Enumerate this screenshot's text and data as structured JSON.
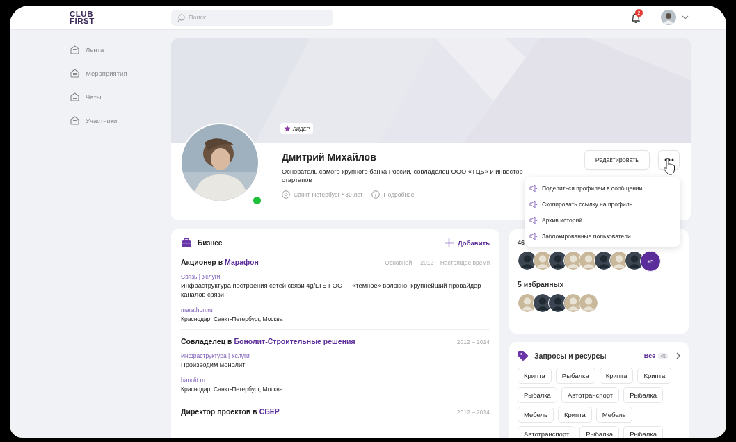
{
  "logo": [
    "CLUB",
    "FIRST"
  ],
  "search": {
    "placeholder": "Поиск"
  },
  "notifications": {
    "count": "2"
  },
  "sidebar": {
    "items": [
      {
        "label": "Лента"
      },
      {
        "label": "Мероприятия"
      },
      {
        "label": "Чаты"
      },
      {
        "label": "Участники"
      }
    ]
  },
  "profile": {
    "badge": "ЛИДЕР",
    "name": "Дмитрий Михайлов",
    "bio": "Основатель самого крупного банка России, совладелец ООО «ТЦБ» и инвестор стартапов",
    "online": true,
    "location": "Санкт-Петербург • 39 лет",
    "details_link": "Подробнее",
    "edit_button": "Редактировать"
  },
  "menu": {
    "items": [
      "Поделиться профилем в сообщении",
      "Скопировать ссылку на профиль",
      "Архив историй",
      "Заблокированные пользователи"
    ]
  },
  "business": {
    "title": "Бизнес",
    "add_button": "Добавить",
    "entries": [
      {
        "role": "Акционер в",
        "company": "Марафон",
        "tag": "Основной",
        "period": "2012 – Настоящее время",
        "categories": "Связь | Услуги",
        "description": "Инфраструктура построения сетей связи 4g/LTE FOC — «тёмное» волокно, крупнейший провайдер каналов связи",
        "site": "marathon.ru",
        "cities": "Краснодар, Санкт-Петербург, Москва"
      },
      {
        "role": "Совладелец в",
        "company": "Бонолит-Строительные решения",
        "period": "2012 – 2014",
        "categories": "Инфраструктура | Услуги",
        "description": "Производим монолит",
        "site": "banolit.ru",
        "cities": "Краснодар, Санкт-Петербург, Москва"
      },
      {
        "role": "Директор проектов в",
        "company": "СБЕР",
        "period": "2012 – 2014"
      }
    ]
  },
  "contacts": {
    "count": "46",
    "avatars": [
      {
        "kind": "dark"
      },
      {
        "kind": "light"
      },
      {
        "kind": "dark"
      },
      {
        "kind": "light"
      },
      {
        "kind": "light"
      },
      {
        "kind": "dark"
      },
      {
        "kind": "light"
      },
      {
        "kind": "dark"
      }
    ],
    "more": "+5",
    "favorites_title": "5 избранных",
    "favorites": [
      {
        "kind": "light"
      },
      {
        "kind": "dark"
      },
      {
        "kind": "dark"
      },
      {
        "kind": "light"
      },
      {
        "kind": "light"
      }
    ]
  },
  "requests": {
    "title": "Запросы и ресурсы",
    "all_link": "Все",
    "count": "45",
    "tags": [
      "Крипта",
      "Рыбалка",
      "Крипта",
      "Крипта",
      "Рыбалка",
      "Автотранспорт",
      "Рыбалка",
      "Мебель",
      "Крипта",
      "Мебель",
      "Автотранспорт",
      "Рыбалка",
      "Рыбалка"
    ]
  }
}
